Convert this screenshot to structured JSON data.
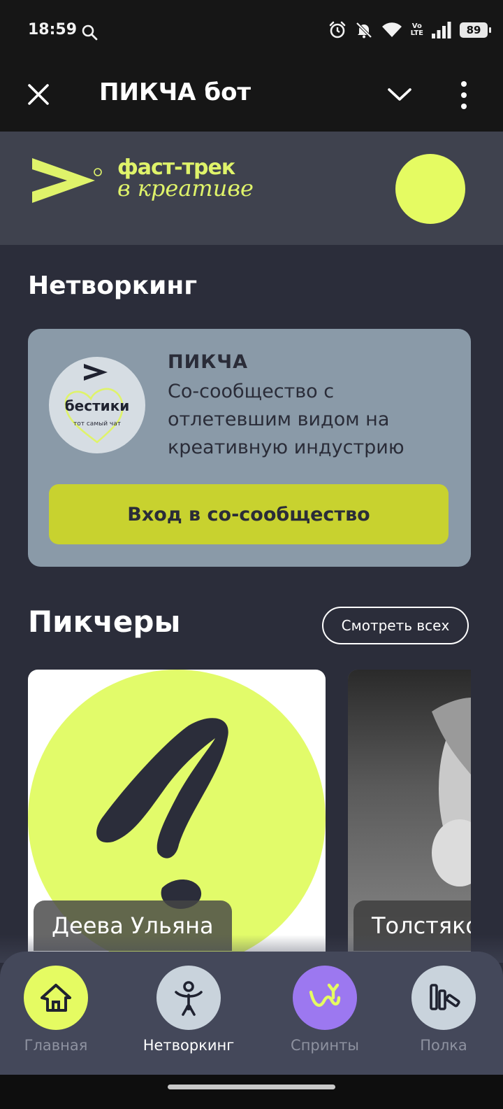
{
  "status_bar": {
    "time": "18:59",
    "battery": "89",
    "network_label_top": "Vo",
    "network_label_bottom": "LTE",
    "icons": [
      "search-icon",
      "alarm-icon",
      "bell-off-icon",
      "wifi-icon",
      "signal-icon",
      "battery-icon"
    ]
  },
  "app_bar": {
    "title": "ПИКЧА бот",
    "icons": [
      "close-icon",
      "chevron-down-icon",
      "more-vertical-icon"
    ]
  },
  "brand": {
    "line1": "фаст-трек",
    "line2": "в креативе",
    "accent_color": "#e5fb62"
  },
  "networking": {
    "section_title": "Нетворкинг",
    "community": {
      "badge_title": "бестики",
      "badge_subtitle": "тот самый чат",
      "name": "ПИКЧА",
      "description": "Со-сообщество с отлетевшим видом на креативную индустрию",
      "join_label": "Вход в со-сообщество"
    }
  },
  "pickers": {
    "section_title": "Пикчеры",
    "see_all_label": "Смотреть всех",
    "items": [
      {
        "name": "Деева Ульяна"
      },
      {
        "name": "Толстяко"
      }
    ]
  },
  "bottom_nav": {
    "items": [
      {
        "label": "Главная",
        "icon": "home-icon",
        "color": "#e5fb62"
      },
      {
        "label": "Нетворкинг",
        "icon": "networking-icon",
        "color": "#c9d3dc"
      },
      {
        "label": "Спринты",
        "icon": "sprints-icon",
        "color": "#9c78f0"
      },
      {
        "label": "Полка",
        "icon": "shelf-icon",
        "color": "#c9d3dc"
      }
    ],
    "active_index": 1
  }
}
